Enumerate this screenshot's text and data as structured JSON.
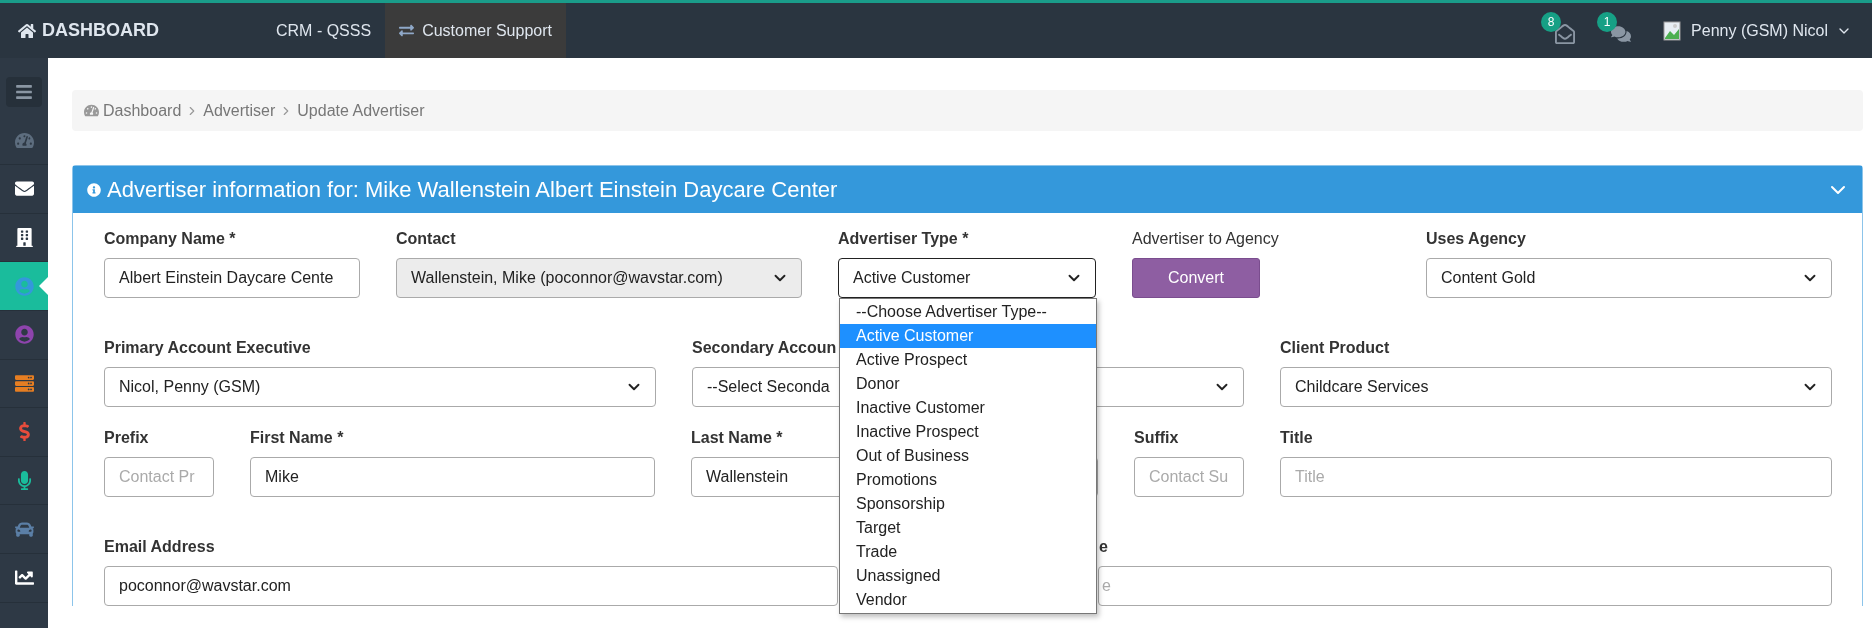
{
  "top_bar": {
    "brand": "DASHBOARD",
    "nav": [
      {
        "label": "CRM - QSSS",
        "selected": false
      },
      {
        "label": "Customer Support",
        "selected": true
      }
    ],
    "notifications": [
      {
        "kind": "mail",
        "count": "8"
      },
      {
        "kind": "chat",
        "count": "1"
      }
    ],
    "user": "Penny (GSM) Nicol"
  },
  "sidebar": {
    "items": [
      {
        "kind": "menu",
        "selected": false,
        "color": "#8a96a3"
      },
      {
        "kind": "gauge",
        "selected": false,
        "color": "#5d6d7e"
      },
      {
        "kind": "mail",
        "selected": false,
        "color": "#ffffff"
      },
      {
        "kind": "building",
        "selected": false,
        "color": "#ffffff"
      },
      {
        "kind": "user",
        "selected": true,
        "color": "#3498db"
      },
      {
        "kind": "user",
        "selected": false,
        "color": "#8e44ad"
      },
      {
        "kind": "server",
        "selected": false,
        "color": "#e67e22"
      },
      {
        "kind": "dollar",
        "selected": false,
        "color": "#e74c3c"
      },
      {
        "kind": "mic",
        "selected": false,
        "color": "#1abc9c"
      },
      {
        "kind": "car",
        "selected": false,
        "color": "#5b7fa6"
      },
      {
        "kind": "chart",
        "selected": false,
        "color": "#ffffff"
      }
    ]
  },
  "breadcrumb": [
    "Dashboard",
    "Advertiser",
    "Update Advertiser"
  ],
  "panel": {
    "title": "Advertiser information for: Mike Wallenstein Albert Einstein Daycare Center",
    "rows": [
      {
        "fields": [
          {
            "kind": "text",
            "label": "Company Name *",
            "value": "Albert Einstein Daycare Cente",
            "disabled": false
          },
          {
            "kind": "select",
            "label": "Contact",
            "value": "Wallenstein, Mike (poconnor@wavstar.com)",
            "disabled": true
          },
          {
            "kind": "select",
            "label": "Advertiser Type *",
            "value": "Active Customer",
            "disabled": false,
            "open": true,
            "options": [
              {
                "label": "--Choose Advertiser Type--",
                "selected": false
              },
              {
                "label": "Active Customer",
                "selected": true
              },
              {
                "label": "Active Prospect",
                "selected": false
              },
              {
                "label": "Donor",
                "selected": false
              },
              {
                "label": "Inactive Customer",
                "selected": false
              },
              {
                "label": "Inactive Prospect",
                "selected": false
              },
              {
                "label": "Out of Business",
                "selected": false
              },
              {
                "label": "Promotions",
                "selected": false
              },
              {
                "label": "Sponsorship",
                "selected": false
              },
              {
                "label": "Target",
                "selected": false
              },
              {
                "label": "Trade",
                "selected": false
              },
              {
                "label": "Unassigned",
                "selected": false
              },
              {
                "label": "Vendor",
                "selected": false
              }
            ]
          },
          {
            "kind": "button",
            "label": "Advertiser to Agency",
            "value": "Convert",
            "disabled": false
          },
          {
            "kind": "select",
            "label": "Uses Agency",
            "value": "Content Gold",
            "disabled": false
          }
        ]
      },
      {
        "fields": [
          {
            "kind": "select",
            "label": "Primary Account Executive",
            "value": "Nicol, Penny (GSM)",
            "disabled": false
          },
          {
            "kind": "select",
            "label": "Secondary Accoun",
            "value": "--Select Seconda",
            "disabled": false
          },
          {
            "kind": "select",
            "label": "Client Product",
            "value": "Childcare Services",
            "disabled": false
          }
        ]
      },
      {
        "fields": [
          {
            "kind": "text",
            "label": "Prefix",
            "placeholder": "Contact Pr",
            "disabled": false
          },
          {
            "kind": "text",
            "label": "First Name *",
            "value": "Mike",
            "disabled": false
          },
          {
            "kind": "text",
            "label": "Last Name *",
            "value": "Wallenstein",
            "disabled": false
          },
          {
            "kind": "text",
            "label": "Suffix",
            "placeholder": "Contact Su",
            "disabled": false
          },
          {
            "kind": "text",
            "label": "Title",
            "placeholder": "Title",
            "disabled": false
          }
        ]
      },
      {
        "fields": [
          {
            "kind": "text",
            "label": "Email Address",
            "value": "poconnor@wavstar.com",
            "disabled": false
          },
          {
            "kind": "text",
            "label": "e",
            "placeholder": "e",
            "disabled": false
          }
        ]
      }
    ]
  }
}
